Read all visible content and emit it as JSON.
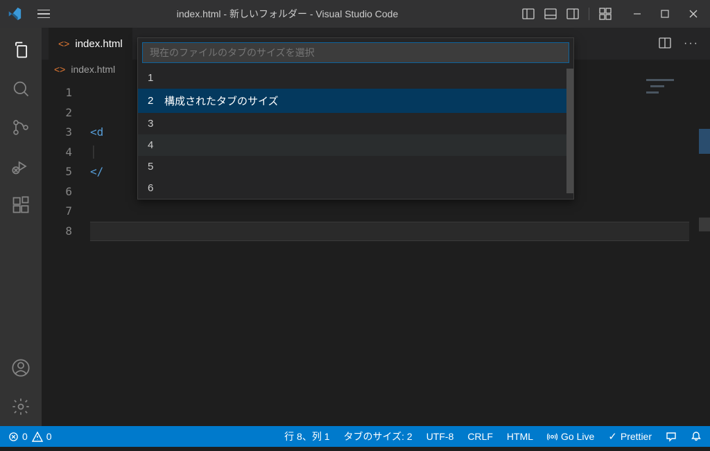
{
  "titlebar": {
    "title": "index.html - 新しいフォルダー - Visual Studio Code"
  },
  "tab": {
    "filename": "index.html"
  },
  "breadcrumb": {
    "filename": "index.html"
  },
  "gutter": {
    "lines": [
      "1",
      "2",
      "3",
      "4",
      "5",
      "6",
      "7",
      "8"
    ]
  },
  "code": {
    "line3": "<d",
    "line5": "</"
  },
  "quickpick": {
    "placeholder": "現在のファイルのタブのサイズを選択",
    "items": [
      {
        "num": "1",
        "label": ""
      },
      {
        "num": "2",
        "label": "構成されたタブのサイズ"
      },
      {
        "num": "3",
        "label": ""
      },
      {
        "num": "4",
        "label": ""
      },
      {
        "num": "5",
        "label": ""
      },
      {
        "num": "6",
        "label": ""
      }
    ]
  },
  "statusbar": {
    "errors": "0",
    "warnings": "0",
    "cursor": "行 8、列 1",
    "tabsize": "タブのサイズ: 2",
    "encoding": "UTF-8",
    "eol": "CRLF",
    "lang": "HTML",
    "golive": "Go Live",
    "prettier": "Prettier"
  }
}
